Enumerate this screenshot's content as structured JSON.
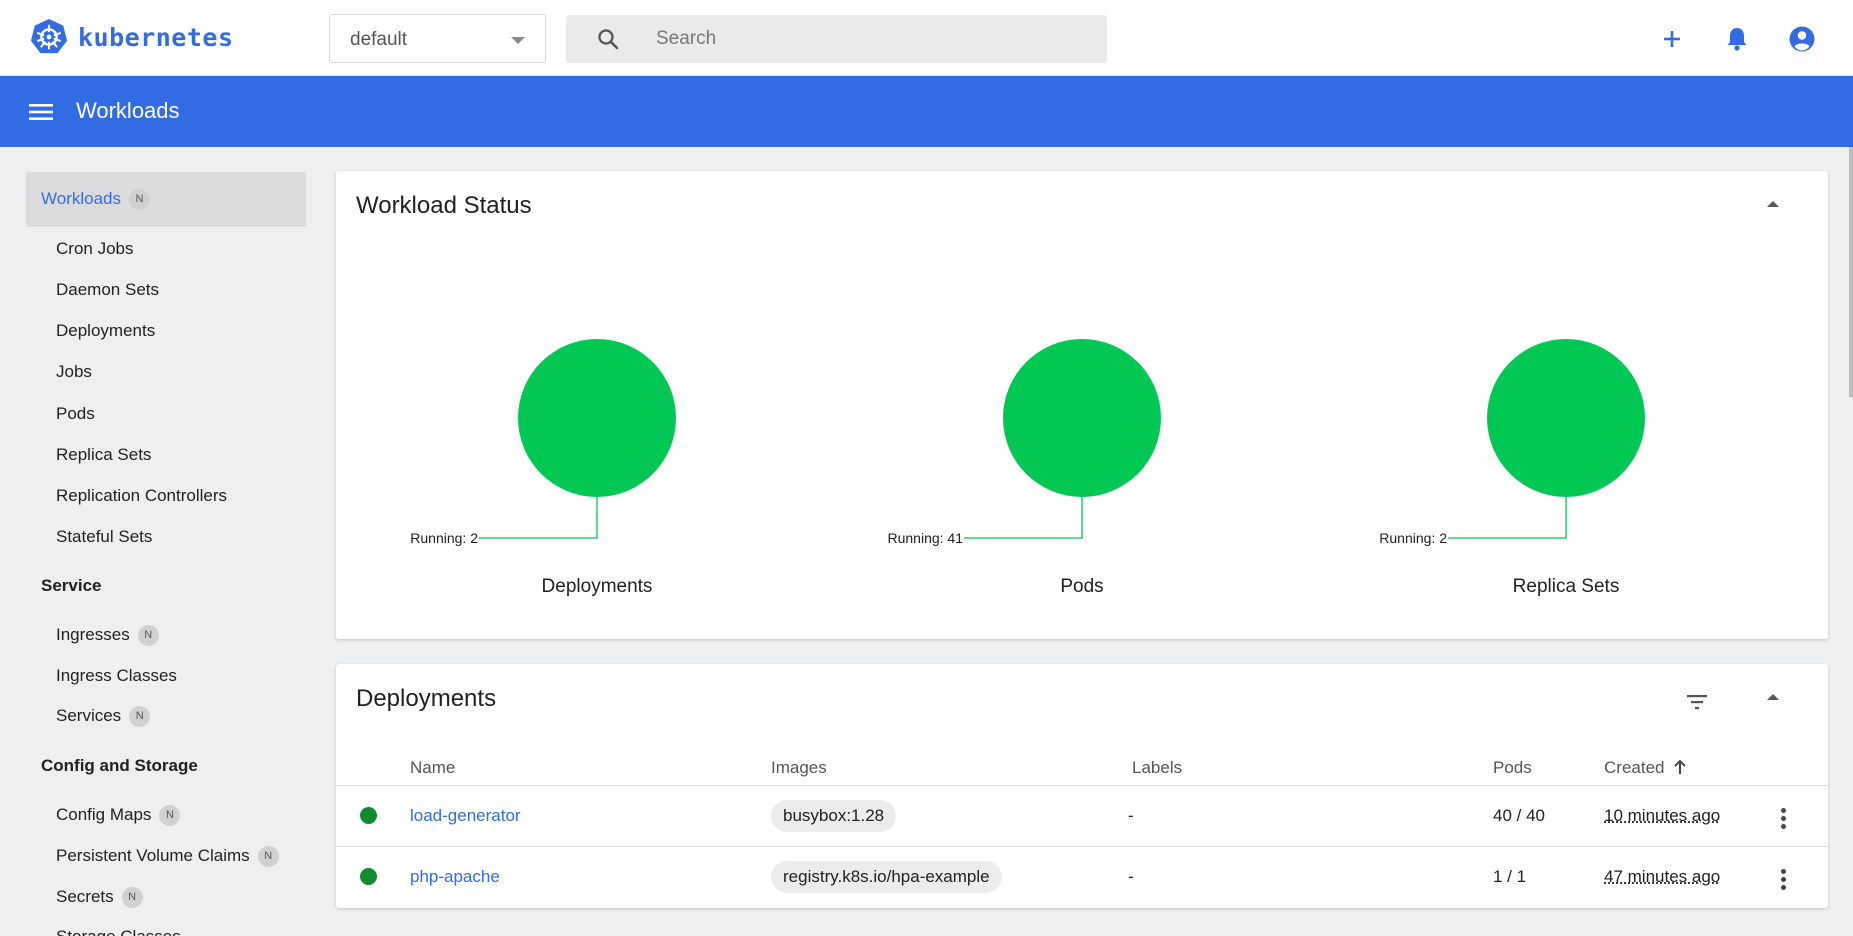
{
  "topbar": {
    "brand": "kubernetes",
    "namespace": "default",
    "search_placeholder": "Search"
  },
  "header": {
    "title": "Workloads"
  },
  "sidebar": {
    "active": {
      "label": "Workloads",
      "badge": "N"
    },
    "workload_items": [
      "Cron Jobs",
      "Daemon Sets",
      "Deployments",
      "Jobs",
      "Pods",
      "Replica Sets",
      "Replication Controllers",
      "Stateful Sets"
    ],
    "service_section": "Service",
    "service_items": [
      {
        "label": "Ingresses",
        "badge": "N"
      },
      {
        "label": "Ingress Classes",
        "badge": ""
      },
      {
        "label": "Services",
        "badge": "N"
      }
    ],
    "config_section": "Config and Storage",
    "config_items": [
      {
        "label": "Config Maps",
        "badge": "N"
      },
      {
        "label": "Persistent Volume Claims",
        "badge": "N"
      },
      {
        "label": "Secrets",
        "badge": "N"
      },
      {
        "label": "Storage Classes",
        "badge": ""
      }
    ]
  },
  "workload_status": {
    "title": "Workload Status",
    "charts": [
      {
        "name": "Deployments",
        "running_label": "Running: 2"
      },
      {
        "name": "Pods",
        "running_label": "Running: 41"
      },
      {
        "name": "Replica Sets",
        "running_label": "Running: 2"
      }
    ]
  },
  "chart_data": [
    {
      "type": "pie",
      "title": "Deployments",
      "slices": [
        {
          "label": "Running",
          "value": 2
        }
      ],
      "colors": [
        "#00c853"
      ]
    },
    {
      "type": "pie",
      "title": "Pods",
      "slices": [
        {
          "label": "Running",
          "value": 41
        }
      ],
      "colors": [
        "#00c853"
      ]
    },
    {
      "type": "pie",
      "title": "Replica Sets",
      "slices": [
        {
          "label": "Running",
          "value": 2
        }
      ],
      "colors": [
        "#00c853"
      ]
    }
  ],
  "deployments": {
    "title": "Deployments",
    "columns": {
      "name": "Name",
      "images": "Images",
      "labels": "Labels",
      "pods": "Pods",
      "created": "Created"
    },
    "rows": [
      {
        "name": "load-generator",
        "image": "busybox:1.28",
        "labels": "-",
        "pods": "40 / 40",
        "created": "10 minutes ago",
        "status": "running"
      },
      {
        "name": "php-apache",
        "image": "registry.k8s.io/hpa-example",
        "labels": "-",
        "pods": "1 / 1",
        "created": "47 minutes ago",
        "status": "running"
      }
    ]
  },
  "colors": {
    "brand": "#326ce5",
    "running": "#00c853",
    "status_ok": "#138d2b"
  }
}
